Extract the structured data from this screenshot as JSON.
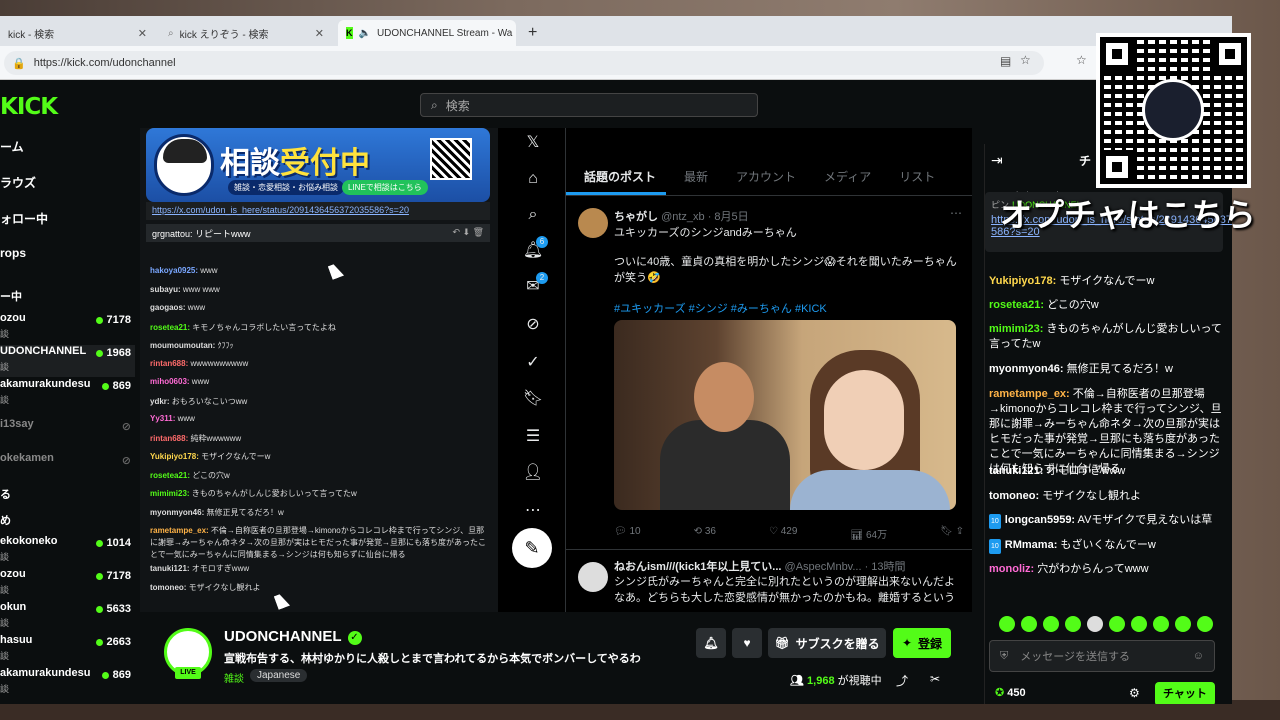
{
  "browser": {
    "tabs": [
      {
        "label": "kick - 検索"
      },
      {
        "label": "kick えりぞう - 検索"
      },
      {
        "label": "UDONCHANNEL Stream - Wa"
      }
    ],
    "new_tab": "+",
    "url": "https://kick.com/udonchannel"
  },
  "header": {
    "logo": "KICK",
    "search_placeholder": "検索"
  },
  "sidebar": {
    "nav": [
      "ーム",
      "ラウズ",
      "ォロー中",
      "rops"
    ],
    "section": "ー中",
    "channels": [
      {
        "name": "ozou",
        "sub": "談",
        "viewers": "7178"
      },
      {
        "name": "UDONCHANNEL",
        "sub": "談",
        "viewers": "1968"
      },
      {
        "name": "akamurakundesu",
        "sub": "談",
        "viewers": "869"
      },
      {
        "name": "i13say",
        "sub": "",
        "viewers": ""
      },
      {
        "name": "okekamen",
        "sub": "",
        "viewers": ""
      },
      {
        "name": "る",
        "sub": "",
        "viewers": ""
      },
      {
        "name": "め",
        "sub": "",
        "viewers": ""
      },
      {
        "name": "ekokoneko",
        "sub": "談",
        "viewers": "1014"
      },
      {
        "name": "ozou",
        "sub": "談",
        "viewers": "7178"
      },
      {
        "name": "okun",
        "sub": "談",
        "viewers": "5633"
      },
      {
        "name": "hasuu",
        "sub": "談",
        "viewers": "2663"
      },
      {
        "name": "akamurakundesu",
        "sub": "談",
        "viewers": "869"
      }
    ]
  },
  "stream": {
    "banner_title_a": "相談",
    "banner_title_b": "受付中",
    "banner_sub": "雑談・恋愛相談・お悩み相談",
    "banner_line": "LINEで相談はこちら",
    "banner_link": "https://x.com/udon_is_here/status/20914364563720355​86?s=20",
    "pinned_msg": "grgnattou: リピートwww",
    "chat": [
      {
        "user": "hakoya0925:",
        "text": " www",
        "color": "#7aa7ff"
      },
      {
        "user": "subayu:",
        "text": " www www",
        "color": "#dddddd"
      },
      {
        "user": "gaogaos:",
        "text": " www",
        "color": "#dddddd"
      },
      {
        "user": "rosetea21:",
        "text": " キモノちゃんコラボしたい言ってたよね",
        "color": "#53fc18"
      },
      {
        "user": "moumoumoutan:",
        "text": " ｸﾌﾌｯ",
        "color": "#dddddd"
      },
      {
        "user": "rintan688:",
        "text": " wwwwwwwwww",
        "color": "#ff6b6b"
      },
      {
        "user": "miho0603:",
        "text": " www",
        "color": "#ff6bd5"
      },
      {
        "user": "ydkr:",
        "text": " おもろいなこいつww",
        "color": "#dddddd"
      },
      {
        "user": "Yy311:",
        "text": " www",
        "color": "#ff6bd5"
      },
      {
        "user": "rintan688:",
        "text": " 純粋wwwwww",
        "color": "#ff6b6b"
      },
      {
        "user": "Yukipiyo178:",
        "text": " モザイクなんでーw",
        "color": "#ffd84d"
      },
      {
        "user": "rosetea21:",
        "text": " どこの穴w",
        "color": "#53fc18"
      },
      {
        "user": "mimimi23:",
        "text": " きものちゃんがしんじ愛おしいって言ってたw",
        "color": "#53fc18"
      },
      {
        "user": "myonmyon46:",
        "text": " 無修正見てるだろ！w",
        "color": "#dddddd"
      },
      {
        "user": "rametampe_ex:",
        "text": " 不倫→自称医者の旦那登場→kimonoからコレコレ枠まで行ってシンジ、旦那に謝罪→みーちゃん命ネタ→次の旦那が実はヒモだった事が発覚→旦那にも落ち度があったことで一気にみーちゃんに同情集まる→シンジは何も知らずに仙台に帰る",
        "color": "#ffb347"
      },
      {
        "user": "tanuki121:",
        "text": " オモロすぎwww",
        "color": "#dddddd"
      },
      {
        "user": "tomoneo:",
        "text": " モザイクなし観れよ",
        "color": "#dddddd"
      }
    ]
  },
  "xapp": {
    "tabs": [
      "話題のポスト",
      "最新",
      "アカウント",
      "メディア",
      "リスト"
    ],
    "notif_badge": "6",
    "msg_badge": "2",
    "post": {
      "name": "ちゃがし",
      "handle": "@ntz_xb · 8月5日",
      "title": "ユキッカーズのシンジandみーちゃん",
      "body": "ついに40歳、童貞の真相を明かしたシンジ😱それを聞いたみーちゃんが笑う🤣",
      "tags": "#ユキッカーズ #シンジ #みーちゃん #KICK",
      "replies": "10",
      "reposts": "36",
      "likes": "429",
      "views": "64万"
    },
    "post2": {
      "name": "ねおんism///(kick1年以上見てい...",
      "handle": "@AspecMnbv... · 13時間",
      "body": "シンジ氏がみーちゃんと完全に別れたというのが理解出来ないんだよなあ。どちらも大した恋愛感情が無かったのかもね。離婚するという"
    }
  },
  "chat": {
    "pinned_user": "ydkr: おもろいなこいつww",
    "pinned_link": "https://x.com/udon_is_here/status/2091436456372035​5​86?s=20",
    "pinned_prefix": "ピン",
    "pinned_name": "UDONCHANNEL",
    "messages": [
      {
        "user": "Yukipiyo178:",
        "text": " モザイクなんでーw",
        "color": "#ffd84d",
        "badge": ""
      },
      {
        "user": "rosetea21:",
        "text": " どこの穴w",
        "color": "#53fc18",
        "badge": ""
      },
      {
        "user": "mimimi23:",
        "text": " きものちゃんがしんじ愛おしいって言ってたw",
        "color": "#53fc18",
        "badge": ""
      },
      {
        "user": "myonmyon46:",
        "text": " 無修正見てるだろ！w",
        "color": "#ffffff",
        "badge": ""
      },
      {
        "user": "rametampe_ex:",
        "text": " 不倫→自称医者の旦那登場→kimonoからコレコレ枠まで行ってシンジ、旦那に謝罪→みーちゃん命ネタ→次の旦那が実はヒモだった事が発覚→旦那にも落ち度があったことで一気にみーちゃんに同情集まる→シンジは何も知らずに仙台に帰る",
        "color": "#ffb347",
        "badge": ""
      },
      {
        "user": "tanuki121:",
        "text": " オモロすぎwww",
        "color": "#ffffff",
        "badge": ""
      },
      {
        "user": "tomoneo:",
        "text": " モザイクなし観れよ",
        "color": "#ffffff",
        "badge": ""
      },
      {
        "user": "longcan5959:",
        "text": " AVモザイクで見えないは草",
        "color": "#ffffff",
        "badge": "10"
      },
      {
        "user": "RMmama:",
        "text": " もざいくなんでーw",
        "color": "#ffffff",
        "badge": "10"
      },
      {
        "user": "monoliz:",
        "text": " 穴がわからんってwww",
        "color": "#ff6bd5",
        "badge": ""
      }
    ],
    "input_placeholder": "メッセージを送信する",
    "points": "450",
    "send_label": "チャット",
    "header_label": "チ"
  },
  "channel": {
    "name": "UDONCHANNEL",
    "title": "宣戦布告する、林村ゆかりに人殺しとまで言われてるから本気でボンバーしてやるわ",
    "category": "雑談",
    "language": "Japanese",
    "live": "LIVE",
    "gift_label": "サブスクを贈る",
    "subscribe_label": "登録",
    "viewer_count": "1,968",
    "viewer_suffix": " が視聴中"
  },
  "overlay": {
    "text": "オプチャはこちら"
  },
  "colors": {
    "accent": "#53fc18",
    "background": "#0b0e0f",
    "x_blue": "#1d9bf0"
  }
}
